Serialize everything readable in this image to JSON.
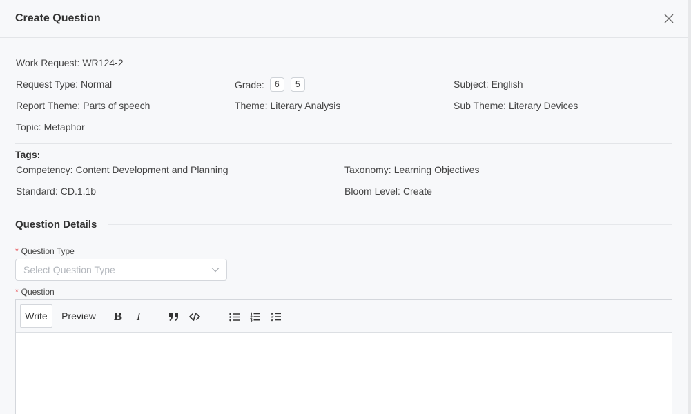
{
  "modal": {
    "title": "Create Question",
    "close_icon": "close-icon"
  },
  "request": {
    "work_request_label": "Work Request:",
    "work_request_value": "WR124-2",
    "request_type_label": "Request Type:",
    "request_type_value": "Normal",
    "grade_label": "Grade:",
    "grades": [
      "6",
      "5"
    ],
    "subject_label": "Subject:",
    "subject_value": "English",
    "report_theme_label": "Report Theme:",
    "report_theme_value": "Parts of speech",
    "theme_label": "Theme:",
    "theme_value": "Literary Analysis",
    "sub_theme_label": "Sub Theme:",
    "sub_theme_value": "Literary Devices",
    "topic_label": "Topic:",
    "topic_value": "Metaphor"
  },
  "tags": {
    "title": "Tags:",
    "competency_label": "Competency:",
    "competency_value": "Content Development and Planning",
    "taxonomy_label": "Taxonomy:",
    "taxonomy_value": "Learning Objectives",
    "standard_label": "Standard:",
    "standard_value": "CD.1.1b",
    "bloom_label": "Bloom Level:",
    "bloom_value": "Create"
  },
  "question_details": {
    "title": "Question Details",
    "required_mark": "*",
    "question_type_label": "Question Type",
    "question_type_placeholder": "Select Question Type",
    "question_label": "Question"
  },
  "editor": {
    "write_tab": "Write",
    "preview_tab": "Preview",
    "active_tab": "Write",
    "tools": [
      "bold-icon",
      "italic-icon",
      "quote-icon",
      "code-icon",
      "bulleted-list-icon",
      "numbered-list-icon",
      "task-list-icon"
    ],
    "bold_glyph": "B",
    "italic_glyph": "I"
  }
}
